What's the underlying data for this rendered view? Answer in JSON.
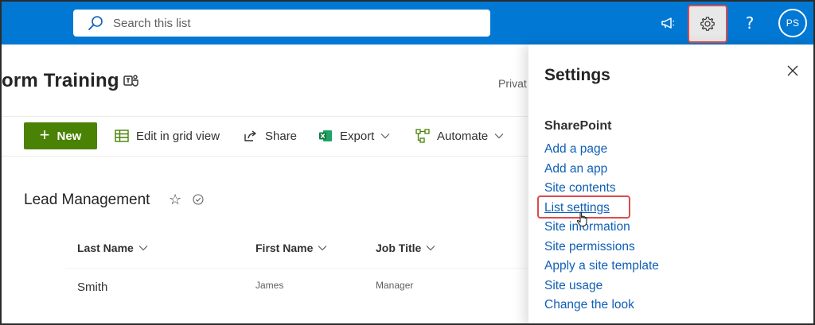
{
  "topbar": {
    "search_placeholder": "Search this list",
    "help_label": "?",
    "avatar_initials": "PS",
    "accent_color": "#0078d4"
  },
  "site": {
    "title": "orm Training",
    "privacy": "Privat"
  },
  "commands": {
    "new": "New",
    "edit_grid": "Edit in grid view",
    "share": "Share",
    "export": "Export",
    "automate": "Automate"
  },
  "list": {
    "title": "Lead Management",
    "columns": [
      "Last Name",
      "First Name",
      "Job Title"
    ],
    "rows": [
      {
        "last_name": "Smith",
        "first_name": "James",
        "job_title": "Manager"
      }
    ]
  },
  "settings_panel": {
    "title": "Settings",
    "section": "SharePoint",
    "links": [
      "Add a page",
      "Add an app",
      "Site contents",
      "List settings",
      "Site information",
      "Site permissions",
      "Apply a site template",
      "Site usage",
      "Change the look"
    ],
    "highlighted_link": "List settings",
    "highlight_color": "#e04a4a"
  }
}
